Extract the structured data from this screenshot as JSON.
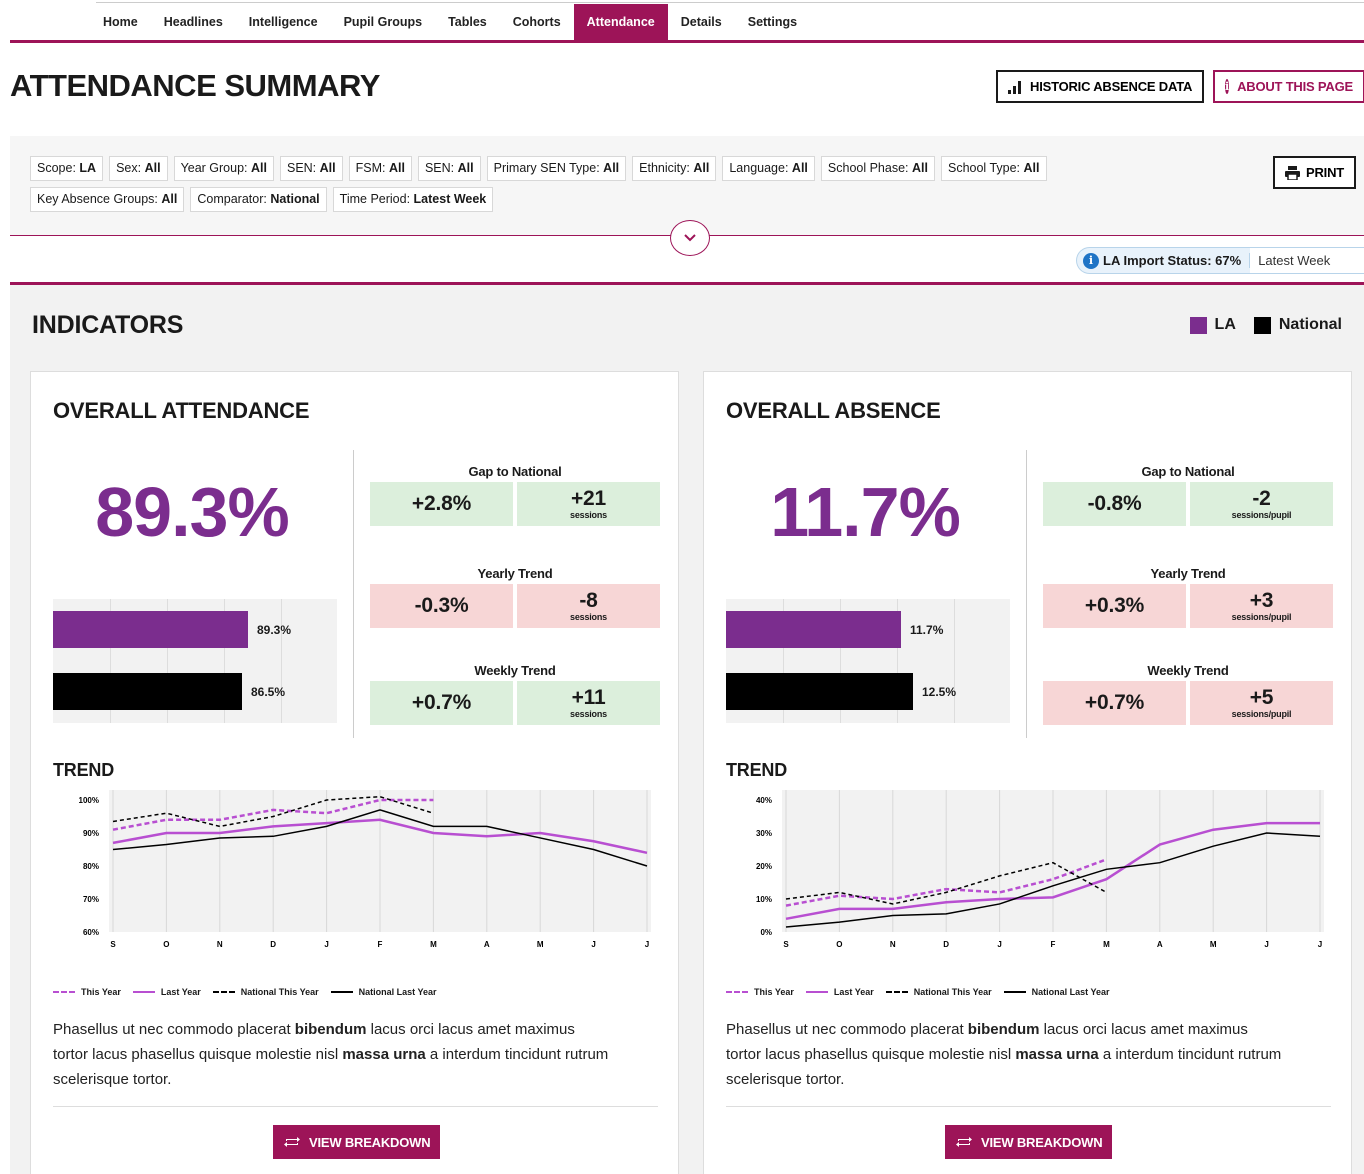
{
  "nav": {
    "items": [
      "Home",
      "Headlines",
      "Intelligence",
      "Pupil Groups",
      "Tables",
      "Cohorts",
      "Attendance",
      "Details",
      "Settings"
    ],
    "active": "Attendance"
  },
  "header": {
    "title": "ATTENDANCE SUMMARY",
    "historic_btn": "HISTORIC ABSENCE DATA",
    "about_btn": "ABOUT THIS PAGE"
  },
  "filters": {
    "chips": [
      {
        "label": "Scope:",
        "value": "LA"
      },
      {
        "label": "Sex:",
        "value": "All"
      },
      {
        "label": "Year Group:",
        "value": "All"
      },
      {
        "label": "SEN:",
        "value": "All"
      },
      {
        "label": "FSM:",
        "value": "All"
      },
      {
        "label": "SEN:",
        "value": "All"
      },
      {
        "label": "Primary SEN Type:",
        "value": "All"
      },
      {
        "label": "Ethnicity:",
        "value": "All"
      },
      {
        "label": "Language:",
        "value": "All"
      },
      {
        "label": "School Phase:",
        "value": "All"
      },
      {
        "label": "School Type:",
        "value": "All"
      },
      {
        "label": "Key Absence Groups:",
        "value": "All"
      },
      {
        "label": "Comparator:",
        "value": "National"
      },
      {
        "label": "Time Period:",
        "value": "Latest Week"
      }
    ],
    "print_btn": "PRINT"
  },
  "import_status": {
    "label": "LA Import Status: 67%",
    "period": "Latest Week"
  },
  "indicators": {
    "title": "INDICATORS",
    "legend": [
      {
        "name": "LA",
        "color": "#7b2d8e"
      },
      {
        "name": "National",
        "color": "#000000"
      }
    ]
  },
  "colors": {
    "accent": "#9d1458",
    "la": "#7b2d8e",
    "la_line": "#b84fd1",
    "national": "#000000",
    "good": "#dcefdc",
    "bad": "#f7d6d6"
  },
  "cards": [
    {
      "title": "OVERALL ATTENDANCE",
      "big_value": "89.3%",
      "bars": {
        "la": 89.3,
        "national": 86.5,
        "la_label": "89.3%",
        "national_label": "86.5%",
        "scale_max": 130
      },
      "kpis": [
        {
          "title": "Gap to National",
          "left": "+2.8%",
          "right": "+21",
          "right_unit": "sessions",
          "status": "green"
        },
        {
          "title": "Yearly Trend",
          "left": "-0.3%",
          "right": "-8",
          "right_unit": "sessions",
          "status": "red"
        },
        {
          "title": "Weekly Trend",
          "left": "+0.7%",
          "right": "+11",
          "right_unit": "sessions",
          "status": "green"
        }
      ],
      "trend_title": "TREND",
      "description": [
        "Phasellus ut nec commodo placerat ",
        "bibendum",
        " lacus orci lacus amet maximus tortor lacus phasellus quisque molestie nisl ",
        "massa urna",
        " a interdum tincidunt rutrum scelerisque tortor."
      ],
      "button": "VIEW BREAKDOWN"
    },
    {
      "title": "OVERALL ABSENCE",
      "big_value": "11.7%",
      "bars": {
        "la": 11.7,
        "national": 12.5,
        "la_label": "11.7%",
        "national_label": "12.5%",
        "scale_max": 19
      },
      "kpis": [
        {
          "title": "Gap to National",
          "left": "-0.8%",
          "right": "-2",
          "right_unit": "sessions/pupil",
          "status": "green"
        },
        {
          "title": "Yearly Trend",
          "left": "+0.3%",
          "right": "+3",
          "right_unit": "sessions/pupil",
          "status": "red"
        },
        {
          "title": "Weekly Trend",
          "left": "+0.7%",
          "right": "+5",
          "right_unit": "sessions/pupil",
          "status": "red"
        }
      ],
      "trend_title": "TREND",
      "description": [
        "Phasellus ut nec commodo placerat ",
        "bibendum",
        " lacus orci lacus amet maximus tortor lacus phasellus quisque molestie nisl ",
        "massa urna",
        " a interdum tincidunt rutrum scelerisque tortor."
      ],
      "button": "VIEW BREAKDOWN"
    }
  ],
  "trend_legend": [
    "This Year",
    "Last Year",
    "National This Year",
    "National Last Year"
  ],
  "chart_data": [
    {
      "type": "line",
      "categories": [
        "S",
        "O",
        "N",
        "D",
        "J",
        "F",
        "M",
        "A",
        "M",
        "J",
        "J"
      ],
      "ylim": [
        60,
        100
      ],
      "yticks": [
        "60%",
        "70%",
        "80%",
        "90%",
        "100%"
      ],
      "series": [
        {
          "name": "This Year",
          "values": [
            91,
            94,
            94,
            97,
            96,
            100,
            100,
            null,
            null,
            null,
            null
          ]
        },
        {
          "name": "Last Year",
          "values": [
            87,
            90,
            90,
            92,
            93,
            94,
            90,
            89,
            90,
            87.5,
            84
          ]
        },
        {
          "name": "National This Year",
          "values": [
            93.5,
            96,
            92,
            95,
            100,
            101,
            96,
            null,
            null,
            null,
            null
          ]
        },
        {
          "name": "National Last Year",
          "values": [
            85,
            86.5,
            88.5,
            89,
            92,
            97,
            92,
            92,
            88.5,
            85,
            80
          ]
        }
      ]
    },
    {
      "type": "line",
      "categories": [
        "S",
        "O",
        "N",
        "D",
        "J",
        "F",
        "M",
        "A",
        "M",
        "J",
        "J"
      ],
      "ylim": [
        0,
        40
      ],
      "yticks": [
        "0%",
        "10%",
        "20%",
        "30%",
        "40%"
      ],
      "series": [
        {
          "name": "This Year",
          "values": [
            8,
            11,
            10,
            13,
            12,
            16,
            22,
            null,
            null,
            null,
            null
          ]
        },
        {
          "name": "Last Year",
          "values": [
            4,
            7,
            7,
            9,
            10,
            10.5,
            16,
            26.5,
            31,
            33,
            33
          ]
        },
        {
          "name": "National This Year",
          "values": [
            10,
            12,
            8.5,
            12,
            17,
            21,
            12,
            null,
            null,
            null,
            null
          ]
        },
        {
          "name": "National Last Year",
          "values": [
            1.5,
            3,
            5,
            5.5,
            8.5,
            14,
            19,
            21,
            26,
            30,
            29
          ]
        }
      ]
    }
  ]
}
